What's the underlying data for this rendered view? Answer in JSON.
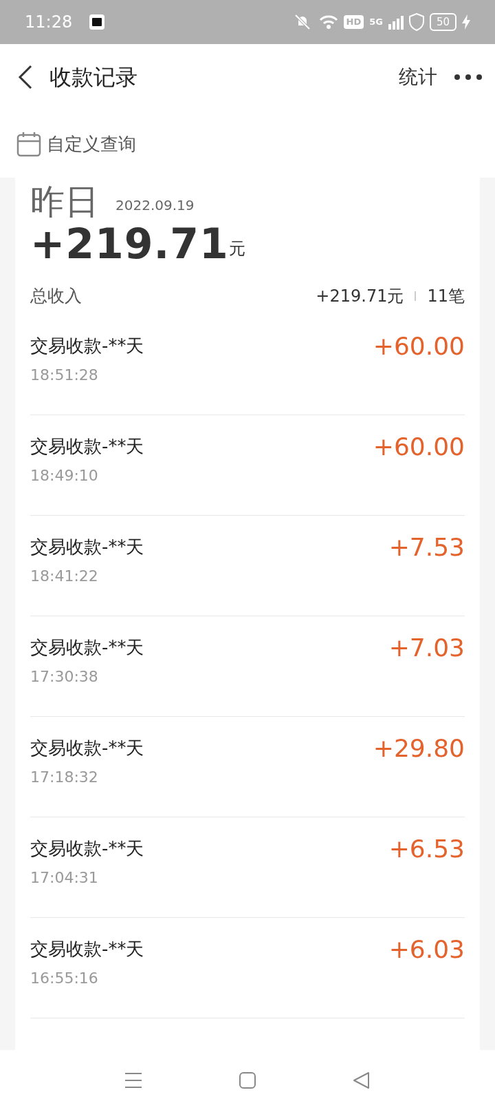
{
  "status_bar": {
    "time": "11:28",
    "network_hd": "HD",
    "network_type": "5G",
    "battery": "50"
  },
  "header": {
    "title": "收款记录",
    "action": "统计"
  },
  "query": {
    "label": "自定义查询"
  },
  "summary": {
    "day": "昨日",
    "date": "2022.09.19",
    "amount": "+219.71",
    "unit": "元",
    "income_label": "总收入",
    "income_total": "+219.71元",
    "count": "11笔"
  },
  "records": [
    {
      "title": "交易收款-**天",
      "time": "18:51:28",
      "amount": "+60.00"
    },
    {
      "title": "交易收款-**天",
      "time": "18:49:10",
      "amount": "+60.00"
    },
    {
      "title": "交易收款-**天",
      "time": "18:41:22",
      "amount": "+7.53"
    },
    {
      "title": "交易收款-**天",
      "time": "17:30:38",
      "amount": "+7.03"
    },
    {
      "title": "交易收款-**天",
      "time": "17:18:32",
      "amount": "+29.80"
    },
    {
      "title": "交易收款-**天",
      "time": "17:04:31",
      "amount": "+6.53"
    },
    {
      "title": "交易收款-**天",
      "time": "16:55:16",
      "amount": "+6.03"
    }
  ]
}
